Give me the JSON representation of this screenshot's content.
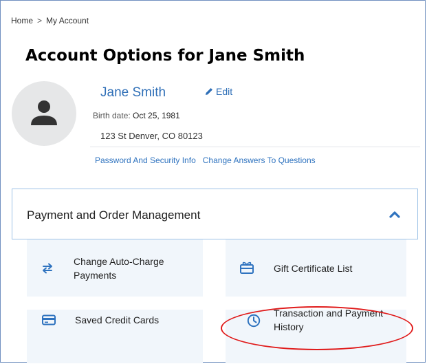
{
  "breadcrumb": {
    "home": "Home",
    "separator": ">",
    "current": "My Account"
  },
  "page_title": "Account Options for Jane Smith",
  "profile": {
    "name": "Jane Smith",
    "edit_label": "Edit",
    "birth_label": "Birth date:",
    "birth_value": "Oct 25, 1981",
    "address": "123 St Denver, CO 80123",
    "links": [
      "Password And Security Info",
      "Change Answers To Questions"
    ]
  },
  "panel": {
    "title": "Payment and Order Management",
    "options": [
      {
        "label_line1": "Change Auto-Charge",
        "label_line2": "Payments",
        "icon": "swap-arrows-icon"
      },
      {
        "label_line1": "Gift Certificate List",
        "label_line2": "",
        "icon": "gift-icon"
      },
      {
        "label_line1": "Saved Credit Cards",
        "label_line2": "",
        "icon": "credit-card-icon"
      },
      {
        "label_line1": "Transaction and Payment",
        "label_line2": "History",
        "icon": "clock-icon"
      }
    ]
  },
  "colors": {
    "link": "#2f73bf",
    "tile_bg": "#f1f6fb",
    "highlight": "#e01b1b"
  }
}
